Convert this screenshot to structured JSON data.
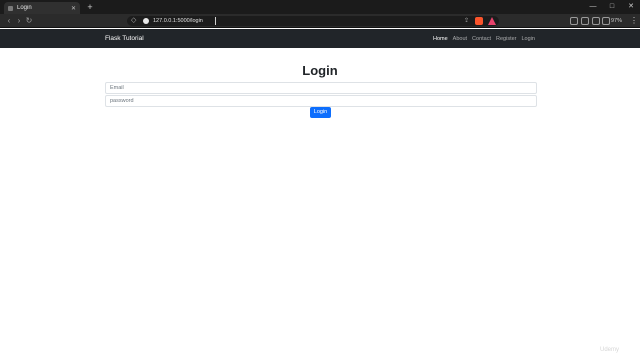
{
  "browser": {
    "tab_title": "Login",
    "tab_close": "✕",
    "new_tab": "+",
    "url": "127.0.0.1:5000/login",
    "battery": "97%",
    "window_controls": {
      "minimize": "—",
      "maximize": "□",
      "close": "✕"
    }
  },
  "navbar": {
    "brand": "Flask Tutorial",
    "links": [
      "Home",
      "About",
      "Contact",
      "Register",
      "Login"
    ],
    "active_link": "Home"
  },
  "page": {
    "title": "Login",
    "email_placeholder": "Email",
    "password_placeholder": "password",
    "submit_label": "Login"
  },
  "watermark": "Udemy",
  "colors": {
    "navbar_bg": "#212529",
    "primary_button": "#0d6efd"
  }
}
